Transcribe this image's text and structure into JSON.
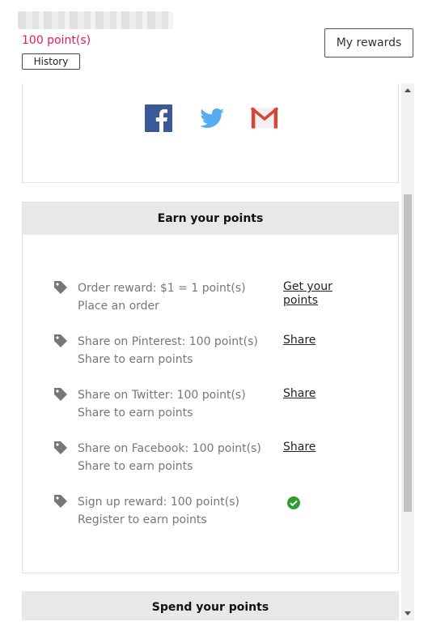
{
  "header": {
    "points_text": "100 point(s)",
    "history_label": "History",
    "my_rewards_label": "My rewards"
  },
  "share_icons": [
    "facebook-icon",
    "twitter-icon",
    "gmail-icon"
  ],
  "earn": {
    "title": "Earn your points",
    "items": [
      {
        "title": "Order reward: $1 = 1 point(s)",
        "subtitle": "Place an order",
        "action": "Get your points"
      },
      {
        "title": "Share on Pinterest: 100 point(s)",
        "subtitle": "Share to earn points",
        "action": "Share"
      },
      {
        "title": "Share on Twitter: 100 point(s)",
        "subtitle": "Share to earn points",
        "action": "Share"
      },
      {
        "title": "Share on Facebook: 100 point(s)",
        "subtitle": "Share to earn points",
        "action": "Share"
      },
      {
        "title": "Sign up reward: 100 point(s)",
        "subtitle": "Register to earn points",
        "status": "completed"
      }
    ]
  },
  "spend": {
    "title": "Spend your points"
  },
  "colors": {
    "points": "#e5195f",
    "facebook": "#3b5998",
    "twitter": "#55acee",
    "gmail": "#d44638",
    "check": "#2e9e2e"
  }
}
